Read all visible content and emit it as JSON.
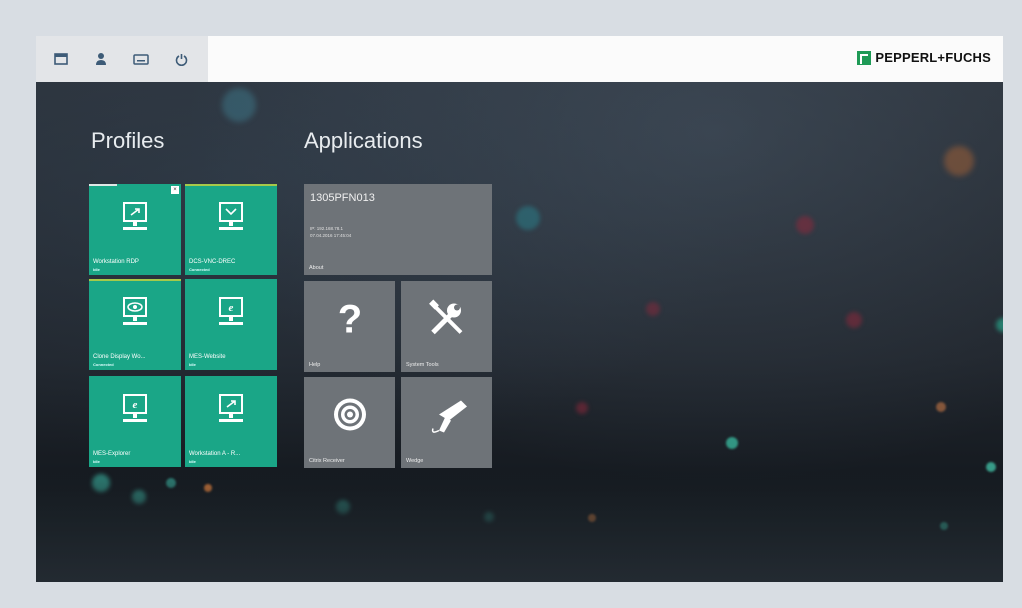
{
  "brand": {
    "logo_text": "PEPPERL+FUCHS",
    "logo_color": "#1e9a56"
  },
  "toolbar": {
    "icons": [
      "window-icon",
      "user-icon",
      "keyboard-icon",
      "power-icon"
    ]
  },
  "sections": {
    "profiles_title": "Profiles",
    "applications_title": "Applications"
  },
  "profiles": [
    {
      "name": "Workstation RDP",
      "status": "Idle",
      "icon": "monitor-remote-icon"
    },
    {
      "name": "DCS-VNC-DREC",
      "status": "Connected",
      "icon": "monitor-vnc-icon"
    },
    {
      "name": "Clone Display Wo...",
      "status": "Connected",
      "icon": "monitor-eye-icon"
    },
    {
      "name": "MES-Website",
      "status": "Idle",
      "icon": "monitor-browser-icon"
    },
    {
      "name": "MES-Explorer",
      "status": "Idle",
      "icon": "monitor-browser-icon"
    },
    {
      "name": "Workstation A - R...",
      "status": "Idle",
      "icon": "monitor-remote-icon"
    }
  ],
  "about": {
    "title": "1305PFN013",
    "line1": "IP: 192.168.78.1",
    "line2": "07.04.2016 17:45:04",
    "label": "About"
  },
  "apps": [
    {
      "label": "Help",
      "icon": "question-icon"
    },
    {
      "label": "System Tools",
      "icon": "tools-icon"
    },
    {
      "label": "Citrix Receiver",
      "icon": "citrix-icon"
    },
    {
      "label": "Wedge",
      "icon": "barcode-scanner-icon"
    }
  ],
  "colors": {
    "profile_tile": "#1aa687",
    "app_tile": "#6e7378",
    "accent_bar": "#a6c94a"
  }
}
